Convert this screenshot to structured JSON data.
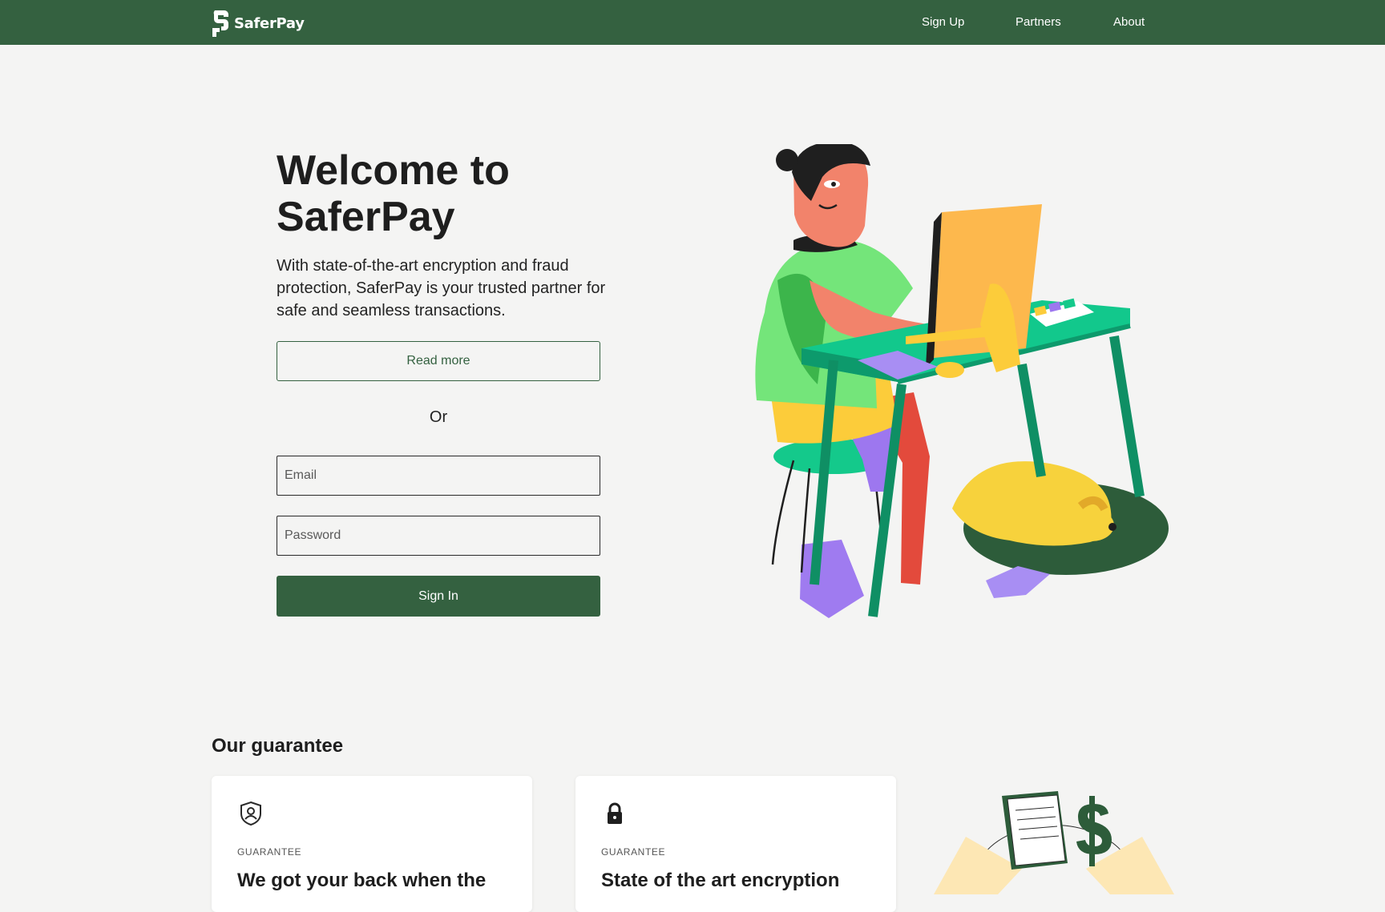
{
  "header": {
    "brand": "SaferPay",
    "nav": [
      "Sign Up",
      "Partners",
      "About"
    ]
  },
  "hero": {
    "title": "Welcome to SaferPay",
    "subtitle": "With state-of-the-art encryption and fraud protection, SaferPay is your trusted partner for safe and seamless transactions.",
    "read_more_label": "Read more",
    "or_label": "Or",
    "email_placeholder": "Email",
    "password_placeholder": "Password",
    "sign_in_label": "Sign In"
  },
  "guarantee": {
    "title": "Our guarantee",
    "cards": [
      {
        "icon": "shield-user-icon",
        "eyebrow": "GUARANTEE",
        "title": "We got your back when the"
      },
      {
        "icon": "lock-icon",
        "eyebrow": "GUARANTEE",
        "title": "State of the art encryption"
      }
    ]
  },
  "colors": {
    "brand_green": "#346140",
    "background": "#f4f4f3",
    "text": "#1e1e1e"
  }
}
